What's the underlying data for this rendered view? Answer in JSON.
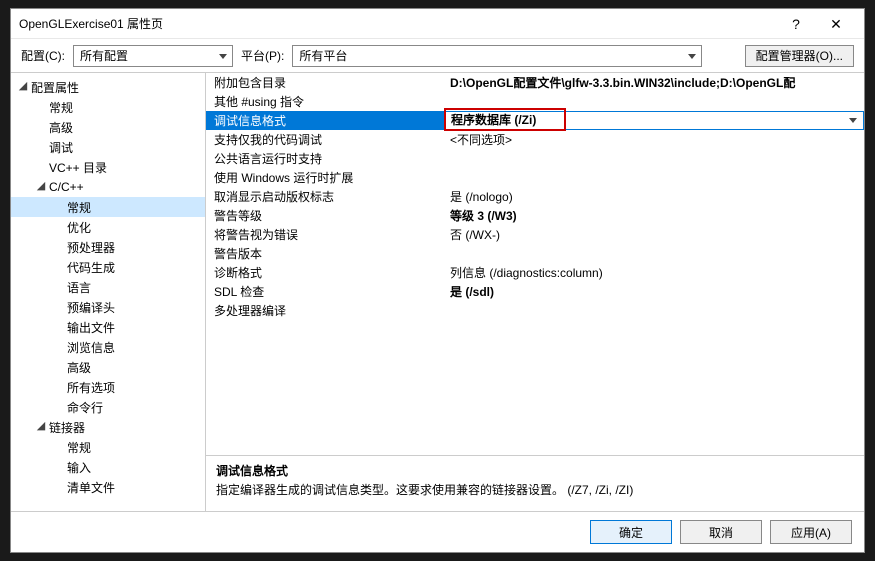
{
  "titlebar": {
    "title": "OpenGLExercise01 属性页",
    "help": "?",
    "close": "✕"
  },
  "toolbar": {
    "config_label": "配置(C):",
    "config_value": "所有配置",
    "platform_label": "平台(P):",
    "platform_value": "所有平台",
    "config_manager_btn": "配置管理器(O)..."
  },
  "tree": {
    "root": "配置属性",
    "items1": [
      "常规",
      "高级",
      "调试",
      "VC++ 目录"
    ],
    "cpp": "C/C++",
    "cpp_items": [
      "常规",
      "优化",
      "预处理器",
      "代码生成",
      "语言",
      "预编译头",
      "输出文件",
      "浏览信息",
      "高级",
      "所有选项",
      "命令行"
    ],
    "linker": "链接器",
    "linker_items": [
      "常规",
      "输入",
      "清单文件"
    ]
  },
  "props": [
    {
      "name": "附加包含目录",
      "val": "D:\\OpenGL配置文件\\glfw-3.3.bin.WIN32\\include;D:\\OpenGL配",
      "bold": true
    },
    {
      "name": "其他 #using 指令",
      "val": ""
    },
    {
      "name": "调试信息格式",
      "val": "程序数据库 (/Zi)",
      "bold": true,
      "selected": true,
      "highlight": true
    },
    {
      "name": "支持仅我的代码调试",
      "val": "<不同选项>"
    },
    {
      "name": "公共语言运行时支持",
      "val": ""
    },
    {
      "name": "使用 Windows 运行时扩展",
      "val": ""
    },
    {
      "name": "取消显示启动版权标志",
      "val": "是 (/nologo)"
    },
    {
      "name": "警告等级",
      "val": "等级 3 (/W3)",
      "bold": true
    },
    {
      "name": "将警告视为错误",
      "val": "否 (/WX-)"
    },
    {
      "name": "警告版本",
      "val": ""
    },
    {
      "name": "诊断格式",
      "val": "列信息 (/diagnostics:column)"
    },
    {
      "name": "SDL 检查",
      "val": "是 (/sdl)",
      "bold": true
    },
    {
      "name": "多处理器编译",
      "val": ""
    }
  ],
  "description": {
    "title": "调试信息格式",
    "text": "指定编译器生成的调试信息类型。这要求使用兼容的链接器设置。   (/Z7, /Zi, /ZI)"
  },
  "footer": {
    "ok": "确定",
    "cancel": "取消",
    "apply": "应用(A)"
  }
}
